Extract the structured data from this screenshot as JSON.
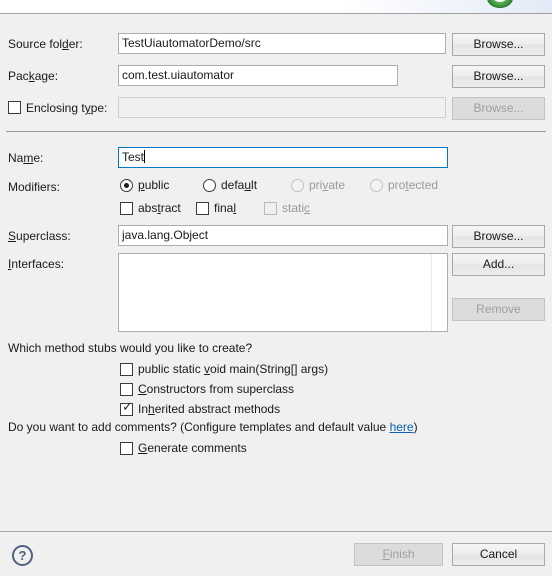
{
  "header": {
    "icon": "green-class-wizard-icon"
  },
  "fields": {
    "source_folder": {
      "label": "Source folder:",
      "value": "TestUiautomatorDemo/src",
      "browse_label": "Browse..."
    },
    "package": {
      "label": "Package:",
      "value": "com.test.uiautomator",
      "browse_label": "Browse..."
    },
    "enclosing_type": {
      "label": "Enclosing type:",
      "checked": false,
      "value": "",
      "browse_label": "Browse...",
      "enabled": false
    },
    "name": {
      "label": "Name:",
      "value": "Test",
      "focused": true
    },
    "superclass": {
      "label": "Superclass:",
      "value": "java.lang.Object",
      "browse_label": "Browse..."
    },
    "interfaces": {
      "label": "Interfaces:",
      "items": [],
      "add_label": "Add...",
      "remove_label": "Remove",
      "remove_enabled": false
    }
  },
  "modifiers": {
    "label": "Modifiers:",
    "radios": [
      {
        "label": "public",
        "selected": true,
        "enabled": true
      },
      {
        "label": "default",
        "selected": false,
        "enabled": true
      },
      {
        "label": "private",
        "selected": false,
        "enabled": false
      },
      {
        "label": "protected",
        "selected": false,
        "enabled": false
      }
    ],
    "checkboxes": [
      {
        "label": "abstract",
        "checked": false,
        "enabled": true
      },
      {
        "label": "final",
        "checked": false,
        "enabled": true
      },
      {
        "label": "static",
        "checked": false,
        "enabled": false
      }
    ]
  },
  "stubs": {
    "question": "Which method stubs would you like to create?",
    "options": [
      {
        "label": "public static void main(String[] args)",
        "checked": false
      },
      {
        "label": "Constructors from superclass",
        "checked": false
      },
      {
        "label": "Inherited abstract methods",
        "checked": true
      }
    ]
  },
  "comments": {
    "question_prefix": "Do you want to add comments? (Configure templates and default value ",
    "link_label": "here",
    "question_suffix": ")",
    "checkbox": {
      "label": "Generate comments",
      "checked": false
    }
  },
  "footer": {
    "help_glyph": "?",
    "finish_label": "Finish",
    "finish_enabled": false,
    "cancel_label": "Cancel"
  },
  "colors": {
    "focus_border": "#0078c8",
    "link": "#0b5fb5",
    "disabled_text": "#9a9a9a",
    "dialog_bg": "#f0f0f0"
  }
}
